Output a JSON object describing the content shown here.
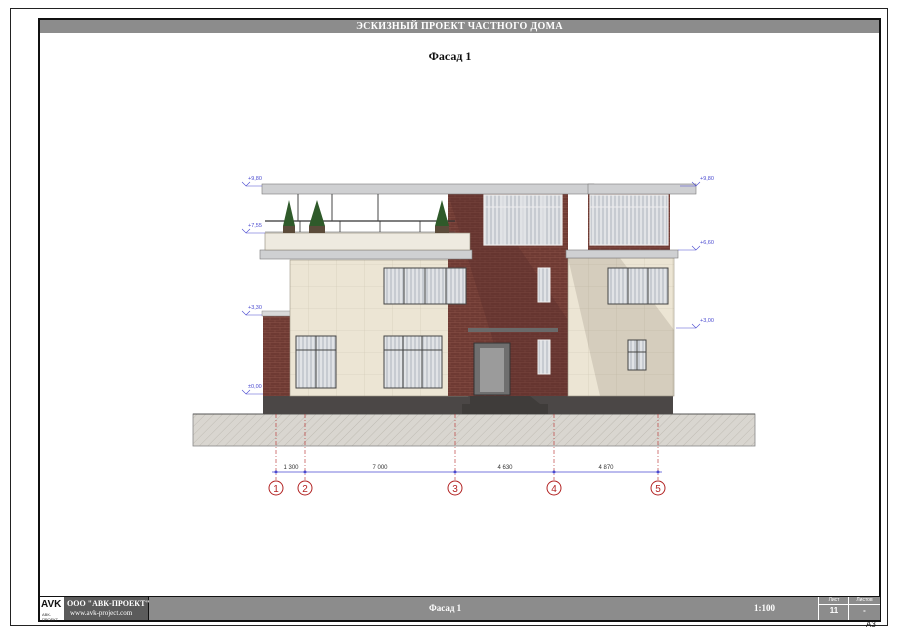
{
  "header": {
    "project_title": "ЭСКИЗНЫЙ ПРОЕКТ ЧАСТНОГО ДОМА"
  },
  "drawing": {
    "title": "Фасад 1",
    "elevation_marks": {
      "left": [
        "+9,80",
        "+7,55",
        "+3,30",
        "±0,00"
      ],
      "right": [
        "+9,80",
        "+6,60",
        "+3,00"
      ]
    },
    "dimensions": [
      "1 300",
      "7 000",
      "4 630",
      "4 870"
    ],
    "axes": [
      "1",
      "2",
      "3",
      "4",
      "5"
    ]
  },
  "footer": {
    "logo": "AVK",
    "logo_sub": "АВК-ПРОЕКТ",
    "company": "ООО \"АВК-ПРОЕКТ\"",
    "website": "www.avk-project.com",
    "sheet_title": "Фасад 1",
    "scale": "1:100",
    "sheet_label": "Лист",
    "sheet_number": "11",
    "sheets_label": "Листов",
    "sheets_total": "-",
    "format": "А3"
  },
  "colors": {
    "brick": "#6e3a33",
    "panel": "#ebe4d3",
    "grey_bar": "#8c8c8c",
    "axis_red": "#b22222",
    "dimension_blue": "#4a4ad0"
  }
}
